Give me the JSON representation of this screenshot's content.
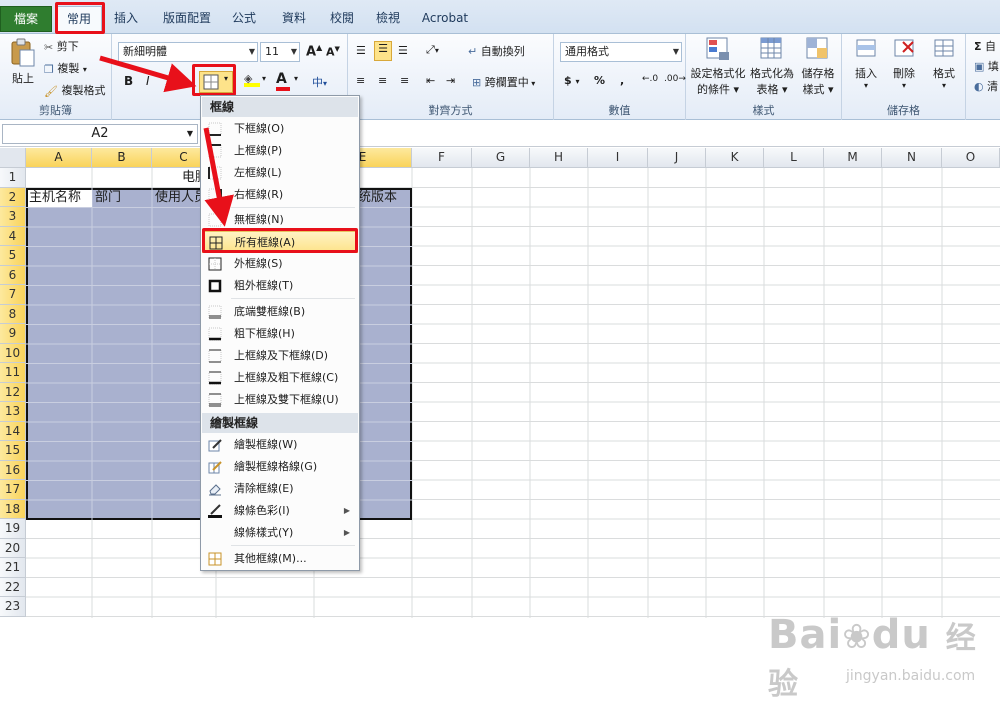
{
  "tabs": [
    "檔案",
    "常用",
    "插入",
    "版面配置",
    "公式",
    "資料",
    "校閱",
    "檢視",
    "Acrobat"
  ],
  "ribbon": {
    "clipboard": {
      "paste": "貼上",
      "cut": "剪下",
      "copy": "複製",
      "format_painter": "複製格式",
      "label": "剪貼簿"
    },
    "font": {
      "name": "新細明體",
      "size": "11",
      "bold": "B",
      "italic": "I",
      "underline": "U",
      "font_color_glyph": "A",
      "increase_glyph": "A",
      "decrease_glyph": "A"
    },
    "alignment": {
      "wrap": "自動換列",
      "merge": "跨欄置中",
      "label": "對齊方式",
      "merge_chinese": "中"
    },
    "number": {
      "format": "通用格式",
      "currency": "$",
      "percent": "%",
      "comma": ",",
      "label": "數值"
    },
    "styles": {
      "conditional": [
        "設定格式化",
        "的條件"
      ],
      "table": [
        "格式化為",
        "表格"
      ],
      "cell": [
        "儲存格",
        "樣式"
      ],
      "label": "樣式"
    },
    "cells": {
      "insert": "插入",
      "delete": "刪除",
      "format": "格式",
      "label": "儲存格"
    },
    "editing": {
      "sum_glyph": "Σ",
      "autosum": "自",
      "fill": "填",
      "clear": "清"
    }
  },
  "formula_bar": {
    "name_box": "A2"
  },
  "grid": {
    "columns": [
      "A",
      "B",
      "C",
      "D",
      "E",
      "F",
      "G",
      "H",
      "I",
      "J",
      "K",
      "L",
      "M",
      "N",
      "O"
    ],
    "rows": [
      "1",
      "2",
      "3",
      "4",
      "5",
      "6",
      "7",
      "8",
      "9",
      "10",
      "11",
      "12",
      "13",
      "14",
      "15",
      "16",
      "17",
      "18",
      "19",
      "20",
      "21",
      "22",
      "23"
    ],
    "row1_title": "电脑",
    "row2": {
      "a": "主机名称",
      "b": "部门",
      "c": "使用人员",
      "e": "统版本"
    }
  },
  "menu": {
    "header_borders": "框線",
    "items_borders": [
      "下框線(O)",
      "上框線(P)",
      "左框線(L)",
      "右框線(R)",
      "無框線(N)",
      "所有框線(A)",
      "外框線(S)",
      "粗外框線(T)",
      "底端雙框線(B)",
      "粗下框線(H)",
      "上框線及下框線(D)",
      "上框線及粗下框線(C)",
      "上框線及雙下框線(U)"
    ],
    "header_draw": "繪製框線",
    "items_draw": [
      "繪製框線(W)",
      "繪製框線格線(G)",
      "清除框線(E)",
      "線條色彩(I)",
      "線條樣式(Y)",
      "其他框線(M)..."
    ],
    "highlighted": "所有框線(A)"
  },
  "watermark": {
    "brand": "Bai",
    "brand_tail": "du",
    "cn": "经验",
    "url": "jingyan.baidu.com"
  },
  "colors": {
    "selection": "#a9b1cf",
    "highlight_red": "#e8101a",
    "file_tab": "#2f7d2f"
  }
}
